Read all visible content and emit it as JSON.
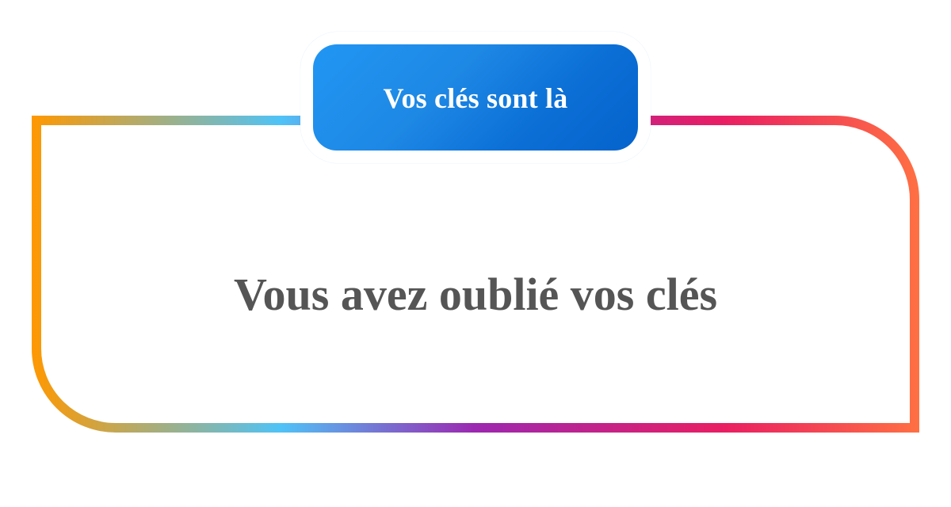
{
  "tab": {
    "label": "Vos clés sont là"
  },
  "message": {
    "text": "Vous avez oublié vos clés"
  },
  "colors": {
    "frame_gradient": [
      "#FF9800",
      "#4FC3F7",
      "#9C27B0",
      "#E91E63",
      "#FF7043"
    ],
    "tab_gradient": [
      "#2196F3",
      "#0563CC"
    ],
    "message_text": "#555555",
    "tab_text": "#FFFFFF"
  }
}
